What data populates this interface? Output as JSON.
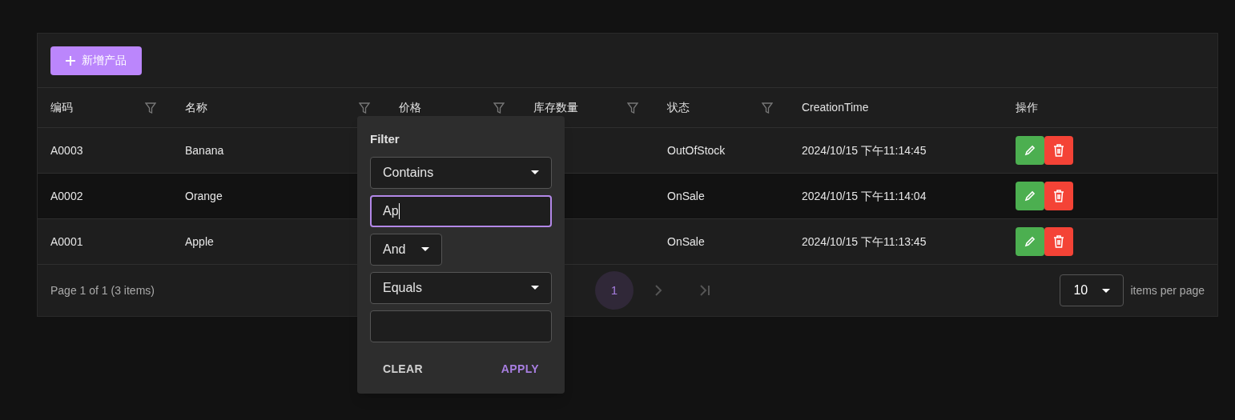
{
  "toolbar": {
    "add_button": "新增产品"
  },
  "table": {
    "columns": [
      {
        "label": "编码",
        "filterable": true
      },
      {
        "label": "名称",
        "filterable": true
      },
      {
        "label": "价格",
        "filterable": true
      },
      {
        "label": "库存数量",
        "filterable": true
      },
      {
        "label": "状态",
        "filterable": true
      },
      {
        "label": "CreationTime",
        "filterable": false
      },
      {
        "label": "操作",
        "filterable": false
      }
    ],
    "rows": [
      {
        "highlighted": false,
        "cells": [
          "A0003",
          "Banana",
          "",
          "",
          "OutOfStock",
          "2024/10/15 下午11:14:45"
        ]
      },
      {
        "highlighted": true,
        "cells": [
          "A0002",
          "Orange",
          "",
          "",
          "OnSale",
          "2024/10/15 下午11:14:04"
        ]
      },
      {
        "highlighted": false,
        "cells": [
          "A0001",
          "Apple",
          "",
          "",
          "OnSale",
          "2024/10/15 下午11:13:45"
        ]
      }
    ]
  },
  "pager": {
    "info": "Page 1 of 1 (3 items)",
    "pages": [
      {
        "label": "1",
        "selected": true
      }
    ],
    "page_size": "10",
    "page_size_label": "items per page"
  },
  "filter_popup": {
    "title": "Filter",
    "operator_1": "Contains",
    "value_1": "Ap",
    "logic": "And",
    "operator_2": "Equals",
    "clear": "CLEAR",
    "apply": "APPLY"
  }
}
